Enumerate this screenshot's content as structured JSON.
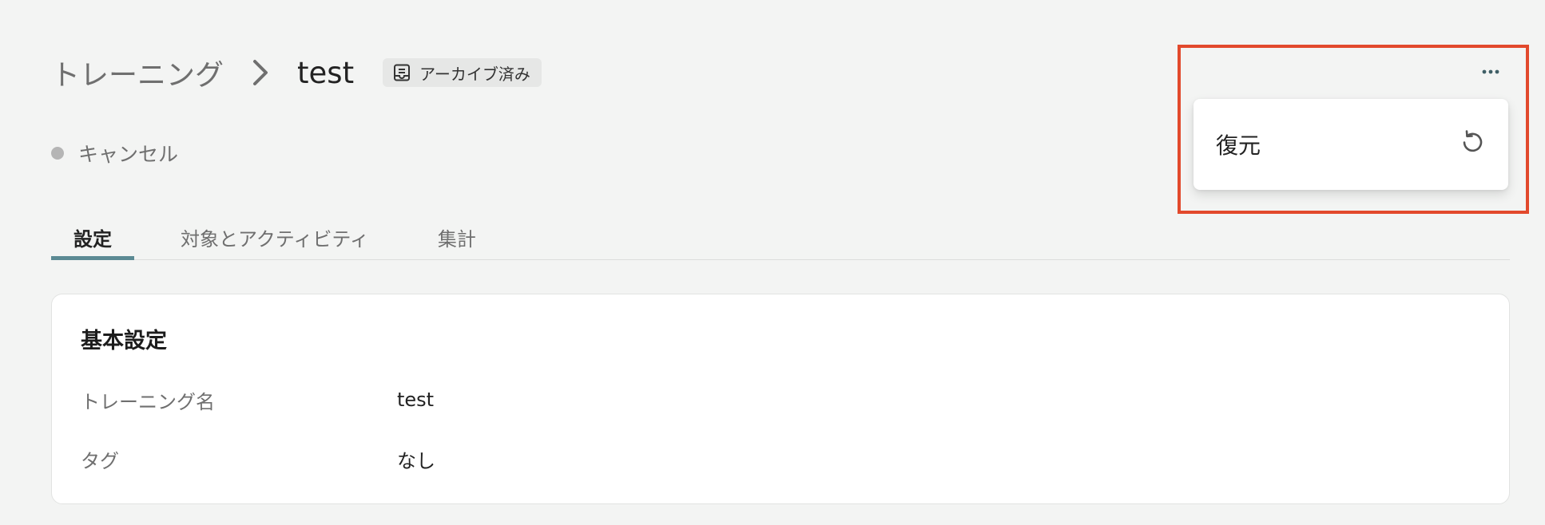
{
  "breadcrumb": {
    "parent": "トレーニング",
    "current": "test",
    "badge": "アーカイブ済み"
  },
  "status": {
    "label": "キャンセル",
    "dot_color": "#b5b5b5"
  },
  "tabs": [
    {
      "label": "設定",
      "active": true
    },
    {
      "label": "対象とアクティビティ",
      "active": false
    },
    {
      "label": "集計",
      "active": false
    }
  ],
  "card": {
    "title": "基本設定",
    "fields": [
      {
        "label": "トレーニング名",
        "value": "test"
      },
      {
        "label": "タグ",
        "value": "なし"
      }
    ]
  },
  "menu": {
    "items": [
      {
        "label": "復元",
        "icon": "restore-icon"
      }
    ]
  },
  "colors": {
    "accent": "#5b8a93",
    "highlight": "#e2492c",
    "background": "#f3f4f3"
  }
}
